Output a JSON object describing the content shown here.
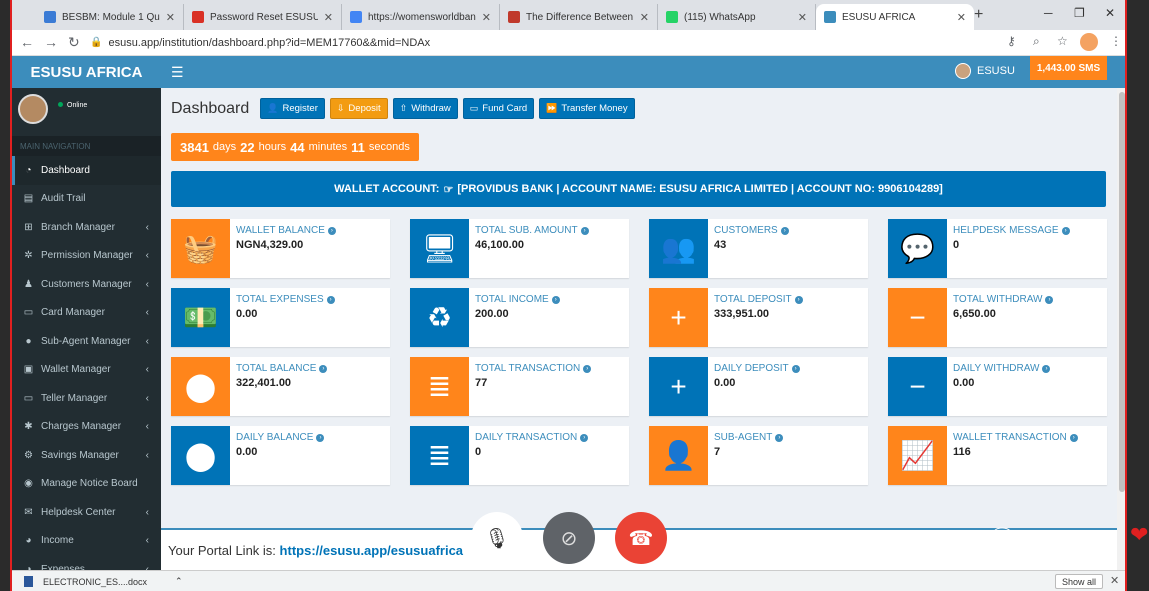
{
  "browser": {
    "tabs": [
      {
        "title": "BESBM: Module 1 Quiz",
        "icon": "tab-favicon-besbm",
        "color": "#3a7bd5"
      },
      {
        "title": "Password Reset ESUSU - esu",
        "icon": "gmail-icon",
        "color": "#d93025"
      },
      {
        "title": "https://womensworldbankin",
        "icon": "tab-favicon-wwb",
        "color": "#4285f4"
      },
      {
        "title": "The Difference Between Bein",
        "icon": "tab-favicon-tn",
        "color": "#c0392b"
      },
      {
        "title": "(115) WhatsApp",
        "icon": "whatsapp-icon",
        "color": "#25d366"
      },
      {
        "title": "ESUSU AFRICA",
        "icon": "tab-favicon-esusu",
        "color": "#3c8dbc"
      }
    ],
    "url": "esusu.app/institution/dashboard.php?id=MEM17760&&mid=NDAx"
  },
  "app": {
    "brand": "ESUSU AFRICA",
    "user_name": "ESUSU",
    "sms_balance": "1,443.00 SMS",
    "status": "Online",
    "nav_header": "MAIN NAVIGATION"
  },
  "sidebar": {
    "items": [
      {
        "label": "Dashboard",
        "icon": "dashboard-icon",
        "glyph": "◔",
        "active": true,
        "chev": ""
      },
      {
        "label": "Audit Trail",
        "icon": "audit-icon",
        "glyph": "▤",
        "active": false,
        "chev": ""
      },
      {
        "label": "Branch Manager",
        "icon": "sitemap-icon",
        "glyph": "⊞",
        "active": false,
        "chev": "‹"
      },
      {
        "label": "Permission Manager",
        "icon": "cogs-icon",
        "glyph": "✲",
        "active": false,
        "chev": "‹"
      },
      {
        "label": "Customers Manager",
        "icon": "users-icon",
        "glyph": "♟",
        "active": false,
        "chev": "‹"
      },
      {
        "label": "Card Manager",
        "icon": "card-icon",
        "glyph": "▭",
        "active": false,
        "chev": "‹"
      },
      {
        "label": "Sub-Agent Manager",
        "icon": "user-icon",
        "glyph": "●",
        "active": false,
        "chev": "‹"
      },
      {
        "label": "Wallet Manager",
        "icon": "wallet-icon",
        "glyph": "▣",
        "active": false,
        "chev": "‹"
      },
      {
        "label": "Teller Manager",
        "icon": "desktop-icon",
        "glyph": "▭",
        "active": false,
        "chev": "‹"
      },
      {
        "label": "Charges Manager",
        "icon": "asterisk-icon",
        "glyph": "✱",
        "active": false,
        "chev": "‹"
      },
      {
        "label": "Savings Manager",
        "icon": "savings-icon",
        "glyph": "⚙",
        "active": false,
        "chev": "‹"
      },
      {
        "label": "Manage Notice Board",
        "icon": "bell-icon",
        "glyph": "◉",
        "active": false,
        "chev": ""
      },
      {
        "label": "Helpdesk Center",
        "icon": "comment-icon",
        "glyph": "✉",
        "active": false,
        "chev": "‹"
      },
      {
        "label": "Income",
        "icon": "income-icon",
        "glyph": "◕",
        "active": false,
        "chev": "‹"
      },
      {
        "label": "Expenses",
        "icon": "expenses-icon",
        "glyph": "◑",
        "active": false,
        "chev": "‹"
      }
    ]
  },
  "dashboard": {
    "title": "Dashboard",
    "buttons": [
      {
        "label": "Register",
        "icon": "user-icon",
        "glyph": "👤",
        "style": "blue"
      },
      {
        "label": "Deposit",
        "icon": "download-icon",
        "glyph": "⇩",
        "style": "orange"
      },
      {
        "label": "Withdraw",
        "icon": "upload-icon",
        "glyph": "⇧",
        "style": "blue"
      },
      {
        "label": "Fund Card",
        "icon": "card-icon",
        "glyph": "▭",
        "style": "blue"
      },
      {
        "label": "Transfer Money",
        "icon": "forward-icon",
        "glyph": "⏩",
        "style": "blue"
      }
    ],
    "timer": {
      "days": "3841",
      "days_unit": "days",
      "hours": "22",
      "hours_unit": "hours",
      "minutes": "44",
      "minutes_unit": "minutes",
      "seconds": "11",
      "seconds_unit": "seconds"
    },
    "wallet_banner": {
      "lead": "WALLET ACCOUNT:",
      "details": "[PROVIDUS BANK | ACCOUNT NAME: ESUSU AFRICA LIMITED | ACCOUNT NO: 9906104289]"
    },
    "boxes": [
      {
        "label": "WALLET BALANCE",
        "value": "NGN4,329.00",
        "icon": "basket-icon",
        "glyph": "🧺",
        "color": "orange"
      },
      {
        "label": "TOTAL SUB. AMOUNT",
        "value": "46,100.00",
        "icon": "monitor-icon",
        "glyph": "🖥",
        "color": "blue"
      },
      {
        "label": "CUSTOMERS",
        "value": "43",
        "icon": "users-icon",
        "glyph": "👥",
        "color": "blue"
      },
      {
        "label": "HELPDESK MESSAGE",
        "value": "0",
        "icon": "comment-icon",
        "glyph": "💬",
        "color": "blue"
      },
      {
        "label": "TOTAL EXPENSES",
        "value": "0.00",
        "icon": "money-icon",
        "glyph": "💵",
        "color": "blue"
      },
      {
        "label": "TOTAL INCOME",
        "value": "200.00",
        "icon": "recycle-icon",
        "glyph": "♻",
        "color": "blue"
      },
      {
        "label": "TOTAL DEPOSIT",
        "value": "333,951.00",
        "icon": "plus-icon",
        "glyph": "+",
        "color": "orange"
      },
      {
        "label": "TOTAL WITHDRAW",
        "value": "6,650.00",
        "icon": "minus-icon",
        "glyph": "−",
        "color": "orange"
      },
      {
        "label": "TOTAL BALANCE",
        "value": "322,401.00",
        "icon": "map-marker-icon",
        "glyph": "⬤",
        "color": "orange"
      },
      {
        "label": "TOTAL TRANSACTION",
        "value": "77",
        "icon": "database-icon",
        "glyph": "≣",
        "color": "orange"
      },
      {
        "label": "DAILY DEPOSIT",
        "value": "0.00",
        "icon": "plus-icon",
        "glyph": "+",
        "color": "blue"
      },
      {
        "label": "DAILY WITHDRAW",
        "value": "0.00",
        "icon": "minus-icon",
        "glyph": "−",
        "color": "blue"
      },
      {
        "label": "DAILY BALANCE",
        "value": "0.00",
        "icon": "map-marker-icon",
        "glyph": "⬤",
        "color": "blue"
      },
      {
        "label": "DAILY TRANSACTION",
        "value": "0",
        "icon": "database-icon",
        "glyph": "≣",
        "color": "blue"
      },
      {
        "label": "SUB-AGENT",
        "value": "7",
        "icon": "user-icon",
        "glyph": "👤",
        "color": "orange"
      },
      {
        "label": "WALLET TRANSACTION",
        "value": "116",
        "icon": "chart-icon",
        "glyph": "📈",
        "color": "orange"
      }
    ],
    "portal_label": "Your Portal Link is:",
    "portal_link": "https://esusu.app/esusuafrica"
  },
  "downloads": {
    "file": "ELECTRONIC_ES....docx",
    "show_all": "Show all"
  }
}
